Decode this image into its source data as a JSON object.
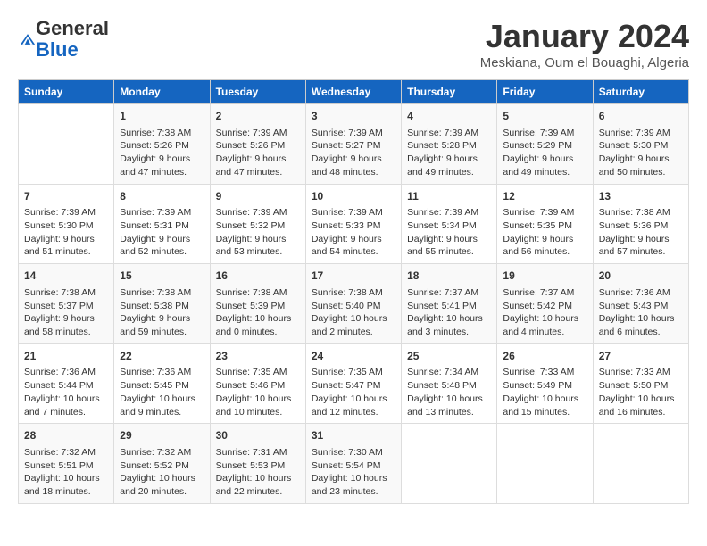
{
  "logo": {
    "line1": "General",
    "line2": "Blue"
  },
  "title": "January 2024",
  "location": "Meskiana, Oum el Bouaghi, Algeria",
  "weekdays": [
    "Sunday",
    "Monday",
    "Tuesday",
    "Wednesday",
    "Thursday",
    "Friday",
    "Saturday"
  ],
  "weeks": [
    [
      {
        "day": null
      },
      {
        "day": "1",
        "sunrise": "7:38 AM",
        "sunset": "5:26 PM",
        "daylight": "9 hours and 47 minutes."
      },
      {
        "day": "2",
        "sunrise": "7:39 AM",
        "sunset": "5:26 PM",
        "daylight": "9 hours and 47 minutes."
      },
      {
        "day": "3",
        "sunrise": "7:39 AM",
        "sunset": "5:27 PM",
        "daylight": "9 hours and 48 minutes."
      },
      {
        "day": "4",
        "sunrise": "7:39 AM",
        "sunset": "5:28 PM",
        "daylight": "9 hours and 49 minutes."
      },
      {
        "day": "5",
        "sunrise": "7:39 AM",
        "sunset": "5:29 PM",
        "daylight": "9 hours and 49 minutes."
      },
      {
        "day": "6",
        "sunrise": "7:39 AM",
        "sunset": "5:30 PM",
        "daylight": "9 hours and 50 minutes."
      }
    ],
    [
      {
        "day": "7",
        "sunrise": "7:39 AM",
        "sunset": "5:30 PM",
        "daylight": "9 hours and 51 minutes."
      },
      {
        "day": "8",
        "sunrise": "7:39 AM",
        "sunset": "5:31 PM",
        "daylight": "9 hours and 52 minutes."
      },
      {
        "day": "9",
        "sunrise": "7:39 AM",
        "sunset": "5:32 PM",
        "daylight": "9 hours and 53 minutes."
      },
      {
        "day": "10",
        "sunrise": "7:39 AM",
        "sunset": "5:33 PM",
        "daylight": "9 hours and 54 minutes."
      },
      {
        "day": "11",
        "sunrise": "7:39 AM",
        "sunset": "5:34 PM",
        "daylight": "9 hours and 55 minutes."
      },
      {
        "day": "12",
        "sunrise": "7:39 AM",
        "sunset": "5:35 PM",
        "daylight": "9 hours and 56 minutes."
      },
      {
        "day": "13",
        "sunrise": "7:38 AM",
        "sunset": "5:36 PM",
        "daylight": "9 hours and 57 minutes."
      }
    ],
    [
      {
        "day": "14",
        "sunrise": "7:38 AM",
        "sunset": "5:37 PM",
        "daylight": "9 hours and 58 minutes."
      },
      {
        "day": "15",
        "sunrise": "7:38 AM",
        "sunset": "5:38 PM",
        "daylight": "9 hours and 59 minutes."
      },
      {
        "day": "16",
        "sunrise": "7:38 AM",
        "sunset": "5:39 PM",
        "daylight": "10 hours and 0 minutes."
      },
      {
        "day": "17",
        "sunrise": "7:38 AM",
        "sunset": "5:40 PM",
        "daylight": "10 hours and 2 minutes."
      },
      {
        "day": "18",
        "sunrise": "7:37 AM",
        "sunset": "5:41 PM",
        "daylight": "10 hours and 3 minutes."
      },
      {
        "day": "19",
        "sunrise": "7:37 AM",
        "sunset": "5:42 PM",
        "daylight": "10 hours and 4 minutes."
      },
      {
        "day": "20",
        "sunrise": "7:36 AM",
        "sunset": "5:43 PM",
        "daylight": "10 hours and 6 minutes."
      }
    ],
    [
      {
        "day": "21",
        "sunrise": "7:36 AM",
        "sunset": "5:44 PM",
        "daylight": "10 hours and 7 minutes."
      },
      {
        "day": "22",
        "sunrise": "7:36 AM",
        "sunset": "5:45 PM",
        "daylight": "10 hours and 9 minutes."
      },
      {
        "day": "23",
        "sunrise": "7:35 AM",
        "sunset": "5:46 PM",
        "daylight": "10 hours and 10 minutes."
      },
      {
        "day": "24",
        "sunrise": "7:35 AM",
        "sunset": "5:47 PM",
        "daylight": "10 hours and 12 minutes."
      },
      {
        "day": "25",
        "sunrise": "7:34 AM",
        "sunset": "5:48 PM",
        "daylight": "10 hours and 13 minutes."
      },
      {
        "day": "26",
        "sunrise": "7:33 AM",
        "sunset": "5:49 PM",
        "daylight": "10 hours and 15 minutes."
      },
      {
        "day": "27",
        "sunrise": "7:33 AM",
        "sunset": "5:50 PM",
        "daylight": "10 hours and 16 minutes."
      }
    ],
    [
      {
        "day": "28",
        "sunrise": "7:32 AM",
        "sunset": "5:51 PM",
        "daylight": "10 hours and 18 minutes."
      },
      {
        "day": "29",
        "sunrise": "7:32 AM",
        "sunset": "5:52 PM",
        "daylight": "10 hours and 20 minutes."
      },
      {
        "day": "30",
        "sunrise": "7:31 AM",
        "sunset": "5:53 PM",
        "daylight": "10 hours and 22 minutes."
      },
      {
        "day": "31",
        "sunrise": "7:30 AM",
        "sunset": "5:54 PM",
        "daylight": "10 hours and 23 minutes."
      },
      {
        "day": null
      },
      {
        "day": null
      },
      {
        "day": null
      }
    ]
  ],
  "labels": {
    "sunrise_prefix": "Sunrise: ",
    "sunset_prefix": "Sunset: ",
    "daylight_prefix": "Daylight: "
  }
}
